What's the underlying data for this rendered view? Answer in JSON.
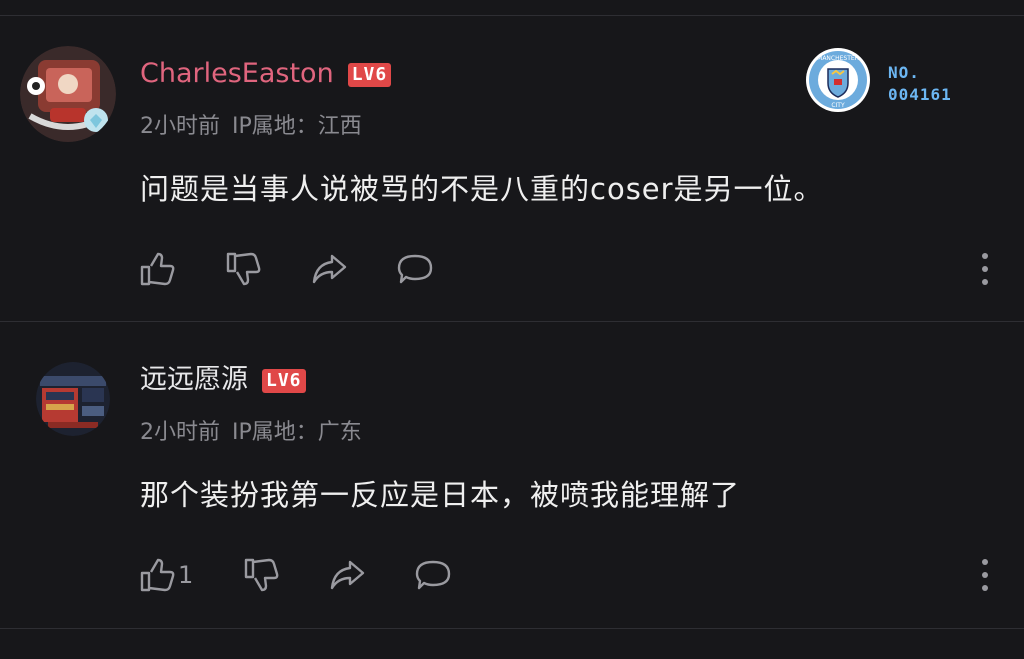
{
  "comments": [
    {
      "username": "CharlesEaston",
      "username_color": "#e0657e",
      "level": "LV6",
      "time": "2小时前",
      "ip": "IP属地：江西",
      "text": "问题是当事人说被骂的不是八重的coser是另一位。",
      "fan_badge": {
        "label": "NO.",
        "number": "004161",
        "club_top_text": "MANCHESTER",
        "club_bottom_text": "CITY"
      },
      "likes": ""
    },
    {
      "username": "远远愿源",
      "username_color": "#e8e8ea",
      "level": "LV6",
      "time": "2小时前",
      "ip": "IP属地：广东",
      "text": "那个装扮我第一反应是日本，被喷我能理解了",
      "likes": "1"
    }
  ],
  "icons": [
    "thumb-up-icon",
    "thumb-down-icon",
    "share-icon",
    "reply-icon",
    "more-vertical-icon"
  ],
  "colors": {
    "background": "#17171a",
    "level_badge": "#e04848",
    "fan_number": "#6cb6f2",
    "meta_text": "#8a8a90"
  }
}
